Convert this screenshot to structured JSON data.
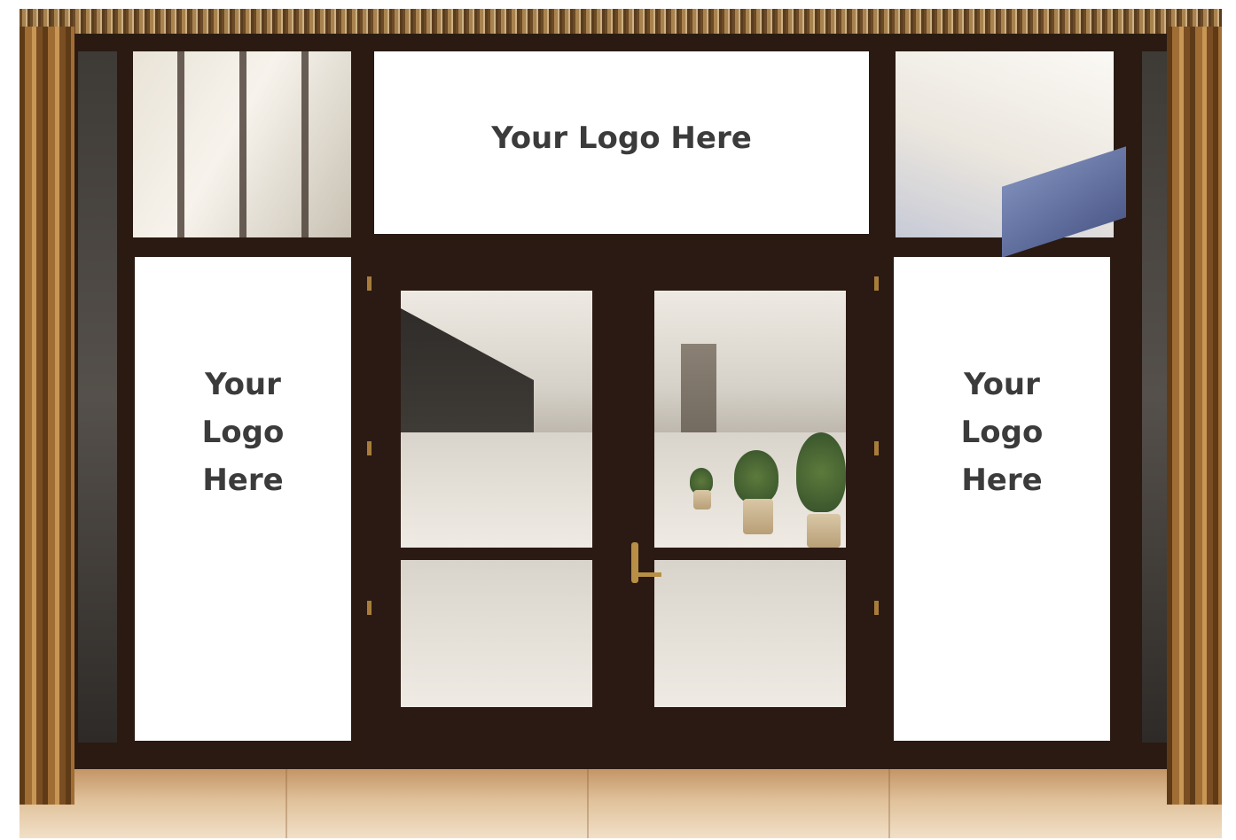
{
  "signs": {
    "top": "Your Logo Here",
    "left": [
      "Your",
      "Logo",
      "Here"
    ],
    "right": [
      "Your",
      "Logo",
      "Here"
    ]
  },
  "colors": {
    "frame": "#2b1a13",
    "sign_background": "#ffffff",
    "sign_text": "#3b3b3b",
    "curtain": "#a06e34",
    "floor": "#e0c19a",
    "hardware": "#b88f45"
  }
}
